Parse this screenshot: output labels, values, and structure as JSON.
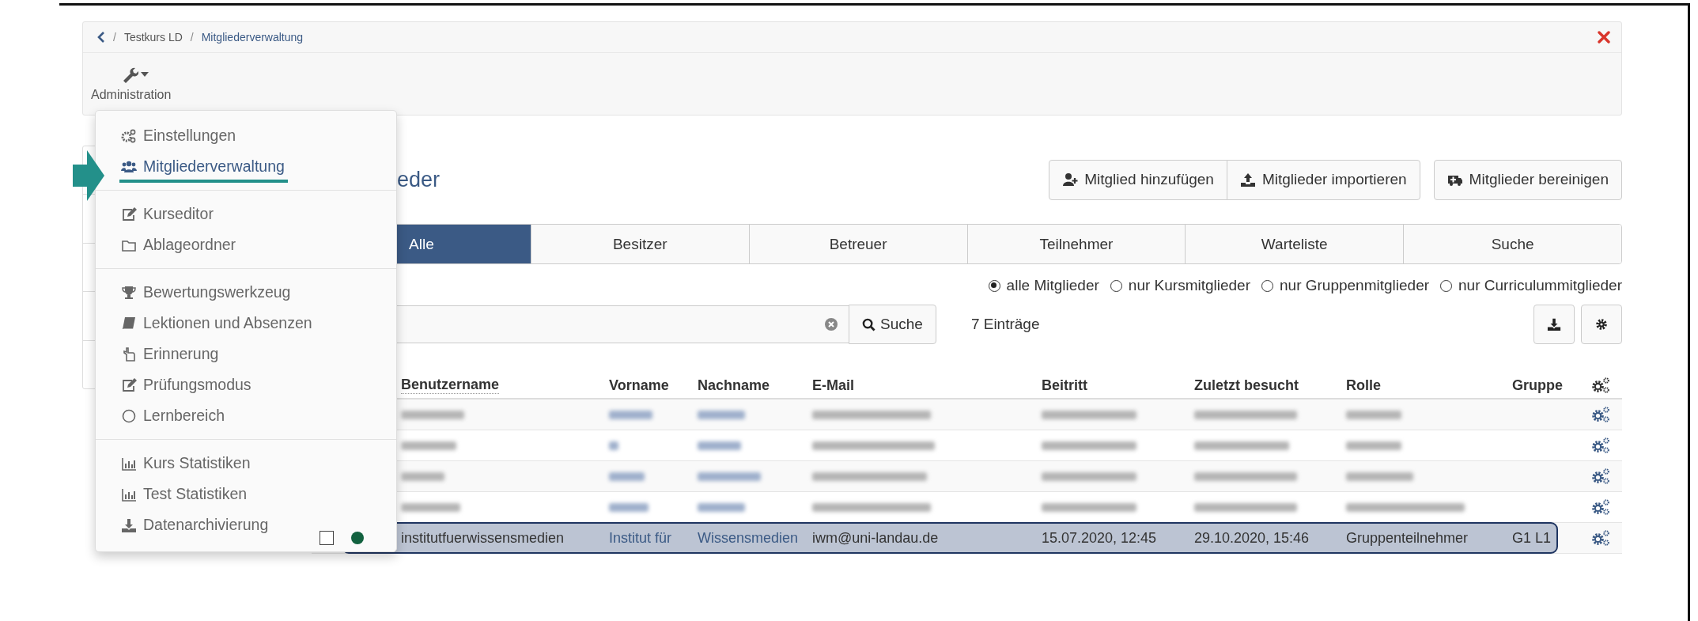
{
  "breadcrumb": {
    "separator": "/",
    "items": [
      "Testkurs LD",
      "Mitgliederverwaltung"
    ]
  },
  "toolbar": {
    "label": "Administration"
  },
  "admin_menu": {
    "groups": [
      [
        {
          "label": "Einstellungen",
          "kind": "gears",
          "selected": false
        },
        {
          "label": "Mitgliederverwaltung",
          "kind": "users",
          "selected": true
        }
      ],
      [
        {
          "label": "Kurseditor",
          "kind": "edit",
          "selected": false
        },
        {
          "label": "Ablageordner",
          "kind": "folder",
          "selected": false
        }
      ],
      [
        {
          "label": "Bewertungswerkzeug",
          "kind": "trophy",
          "selected": false
        },
        {
          "label": "Lektionen und Absenzen",
          "kind": "book",
          "selected": false
        },
        {
          "label": "Erinnerung",
          "kind": "hand",
          "selected": false
        },
        {
          "label": "Prüfungsmodus",
          "kind": "edit",
          "selected": false
        },
        {
          "label": "Lernbereich",
          "kind": "circle",
          "selected": false
        }
      ],
      [
        {
          "label": "Kurs Statistiken",
          "kind": "chart",
          "selected": false
        },
        {
          "label": "Test Statistiken",
          "kind": "chart",
          "selected": false
        },
        {
          "label": "Datenarchivierung",
          "kind": "download",
          "selected": false
        }
      ]
    ]
  },
  "page_title": "eder",
  "action_groups": [
    [
      {
        "label": "Mitglied hinzufügen",
        "kind": "user-plus"
      },
      {
        "label": "Mitglieder importieren",
        "kind": "upload"
      }
    ],
    [
      {
        "label": "Mitglieder bereinigen",
        "kind": "van"
      }
    ]
  ],
  "tabs": [
    {
      "label": "Alle",
      "selected": true
    },
    {
      "label": "Besitzer",
      "selected": false
    },
    {
      "label": "Betreuer",
      "selected": false
    },
    {
      "label": "Teilnehmer",
      "selected": false
    },
    {
      "label": "Warteliste",
      "selected": false
    },
    {
      "label": "Suche",
      "selected": false
    }
  ],
  "filter_options": [
    {
      "label": "alle Mitglieder",
      "selected": true
    },
    {
      "label": "nur Kursmitglieder",
      "selected": false
    },
    {
      "label": "nur Gruppenmitglieder",
      "selected": false
    },
    {
      "label": "nur Curriculummitglieder",
      "selected": false
    }
  ],
  "search": {
    "button": "Suche",
    "count": "7 Einträge"
  },
  "table": {
    "columns": [
      "Benutzername",
      "Vorname",
      "Nachname",
      "E-Mail",
      "Beitritt",
      "Zuletzt besucht",
      "Rolle",
      "Gruppe"
    ],
    "rows": [
      {
        "kind": "redacted",
        "selected": false
      },
      {
        "kind": "redacted",
        "selected": false
      },
      {
        "kind": "redacted",
        "selected": false
      },
      {
        "kind": "redacted",
        "selected": false
      },
      {
        "kind": "member",
        "selected": true,
        "checked": false,
        "color": "#12613f",
        "cells": [
          "institutfuerwissensmedien",
          "Institut für",
          "Wissensmedien",
          "iwm@uni-landau.de",
          "15.07.2020, 12:45",
          "29.10.2020, 15:46",
          "Gruppenteilnehmer",
          "G1 L1"
        ]
      }
    ]
  }
}
